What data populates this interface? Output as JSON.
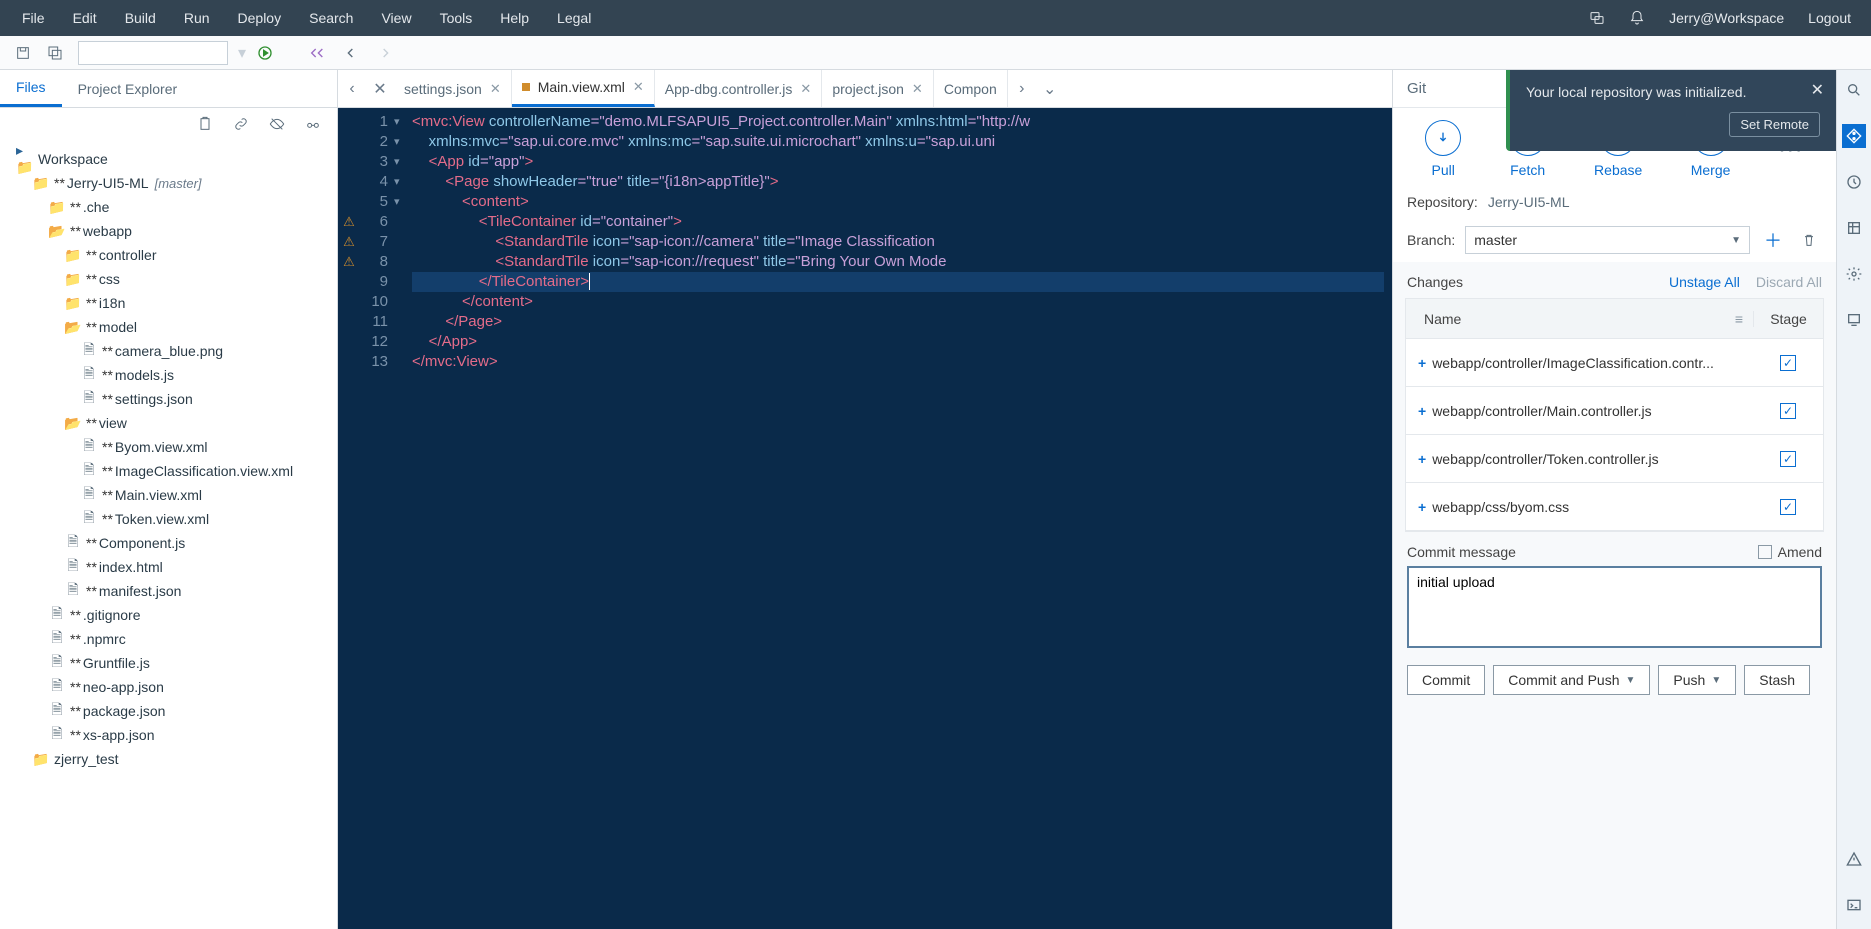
{
  "menubar": [
    "File",
    "Edit",
    "Build",
    "Run",
    "Deploy",
    "Search",
    "View",
    "Tools",
    "Help",
    "Legal"
  ],
  "user": "Jerry@Workspace",
  "logout": "Logout",
  "left_tabs": {
    "files": "Files",
    "explorer": "Project Explorer"
  },
  "tree": {
    "root": "Workspace",
    "project": "Jerry-UI5-ML",
    "project_branch": "[master]",
    "items": [
      ".che",
      "webapp",
      "controller",
      "css",
      "i18n",
      "model",
      "camera_blue.png",
      "models.js",
      "settings.json",
      "view",
      "Byom.view.xml",
      "ImageClassification.view.xml",
      "Main.view.xml",
      "Token.view.xml",
      "Component.js",
      "index.html",
      "manifest.json",
      ".gitignore",
      ".npmrc",
      "Gruntfile.js",
      "neo-app.json",
      "package.json",
      "xs-app.json",
      "zjerry_test"
    ]
  },
  "editor_tabs": [
    "settings.json",
    "Main.view.xml",
    "App-dbg.controller.js",
    "project.json",
    "Compon"
  ],
  "active_tab": "Main.view.xml",
  "code_lines": [
    [
      {
        "c": "t-tag",
        "t": "<mvc:View "
      },
      {
        "c": "t-attr",
        "t": "controllerName"
      },
      {
        "c": "t-eq",
        "t": "="
      },
      {
        "c": "t-str",
        "t": "\"demo.MLFSAPUI5_Project.controller.Main\""
      },
      {
        "c": "t-attr",
        "t": " xmlns:html"
      },
      {
        "c": "t-eq",
        "t": "="
      },
      {
        "c": "t-str",
        "t": "\"http://w"
      }
    ],
    [
      {
        "c": "",
        "t": "    "
      },
      {
        "c": "t-attr",
        "t": "xmlns:mvc"
      },
      {
        "c": "t-eq",
        "t": "="
      },
      {
        "c": "t-str",
        "t": "\"sap.ui.core.mvc\""
      },
      {
        "c": "t-attr",
        "t": " xmlns:mc"
      },
      {
        "c": "t-eq",
        "t": "="
      },
      {
        "c": "t-str",
        "t": "\"sap.suite.ui.microchart\""
      },
      {
        "c": "t-attr",
        "t": " xmlns:u"
      },
      {
        "c": "t-eq",
        "t": "="
      },
      {
        "c": "t-str",
        "t": "\"sap.ui.uni"
      }
    ],
    [
      {
        "c": "",
        "t": "    "
      },
      {
        "c": "t-tag",
        "t": "<App "
      },
      {
        "c": "t-attr",
        "t": "id"
      },
      {
        "c": "t-eq",
        "t": "="
      },
      {
        "c": "t-str",
        "t": "\"app\""
      },
      {
        "c": "t-tag",
        "t": ">"
      }
    ],
    [
      {
        "c": "",
        "t": "        "
      },
      {
        "c": "t-tag",
        "t": "<Page "
      },
      {
        "c": "t-attr",
        "t": "showHeader"
      },
      {
        "c": "t-eq",
        "t": "="
      },
      {
        "c": "t-str",
        "t": "\"true\""
      },
      {
        "c": "t-attr",
        "t": " title"
      },
      {
        "c": "t-eq",
        "t": "="
      },
      {
        "c": "t-str",
        "t": "\"{i18n>appTitle}\""
      },
      {
        "c": "t-tag",
        "t": ">"
      }
    ],
    [
      {
        "c": "",
        "t": "            "
      },
      {
        "c": "t-tag",
        "t": "<content>"
      }
    ],
    [
      {
        "c": "",
        "t": "                "
      },
      {
        "c": "t-tag",
        "t": "<TileContainer "
      },
      {
        "c": "t-attr",
        "t": "id"
      },
      {
        "c": "t-eq",
        "t": "="
      },
      {
        "c": "t-str",
        "t": "\"container\""
      },
      {
        "c": "t-tag",
        "t": ">"
      }
    ],
    [
      {
        "c": "",
        "t": "                    "
      },
      {
        "c": "t-tag",
        "t": "<StandardTile "
      },
      {
        "c": "t-attr",
        "t": "icon"
      },
      {
        "c": "t-eq",
        "t": "="
      },
      {
        "c": "t-str",
        "t": "\"sap-icon://camera\""
      },
      {
        "c": "t-attr",
        "t": " title"
      },
      {
        "c": "t-eq",
        "t": "="
      },
      {
        "c": "t-str",
        "t": "\"Image Classification"
      }
    ],
    [
      {
        "c": "",
        "t": "                    "
      },
      {
        "c": "t-tag",
        "t": "<StandardTile "
      },
      {
        "c": "t-attr",
        "t": "icon"
      },
      {
        "c": "t-eq",
        "t": "="
      },
      {
        "c": "t-str",
        "t": "\"sap-icon://request\""
      },
      {
        "c": "t-attr",
        "t": " title"
      },
      {
        "c": "t-eq",
        "t": "="
      },
      {
        "c": "t-str",
        "t": "\"Bring Your Own Mode"
      }
    ],
    [
      {
        "c": "",
        "t": "                "
      },
      {
        "c": "t-tag",
        "t": "</TileContainer>"
      }
    ],
    [
      {
        "c": "",
        "t": "            "
      },
      {
        "c": "t-tag",
        "t": "</content>"
      }
    ],
    [
      {
        "c": "",
        "t": "        "
      },
      {
        "c": "t-tag",
        "t": "</Page>"
      }
    ],
    [
      {
        "c": "",
        "t": "    "
      },
      {
        "c": "t-tag",
        "t": "</App>"
      }
    ],
    [
      {
        "c": "t-tag",
        "t": "</mvc:View>"
      }
    ]
  ],
  "warnings": [
    6,
    7,
    8
  ],
  "git": {
    "title": "Git",
    "actions": {
      "pull": "Pull",
      "fetch": "Fetch",
      "rebase": "Rebase",
      "merge": "Merge"
    },
    "repo_label": "Repository:",
    "repo": "Jerry-UI5-ML",
    "branch_label": "Branch:",
    "branch": "master",
    "changes_label": "Changes",
    "unstage": "Unstage All",
    "discard": "Discard All",
    "col_name": "Name",
    "col_stage": "Stage",
    "files": [
      "webapp/controller/ImageClassification.contr...",
      "webapp/controller/Main.controller.js",
      "webapp/controller/Token.controller.js",
      "webapp/css/byom.css"
    ],
    "commit_label": "Commit message",
    "amend": "Amend",
    "commit_msg": "initial upload",
    "btn_commit": "Commit",
    "btn_commit_push": "Commit and Push",
    "btn_push": "Push",
    "btn_stash": "Stash"
  },
  "notif": {
    "msg": "Your local repository was initialized.",
    "btn": "Set Remote"
  }
}
